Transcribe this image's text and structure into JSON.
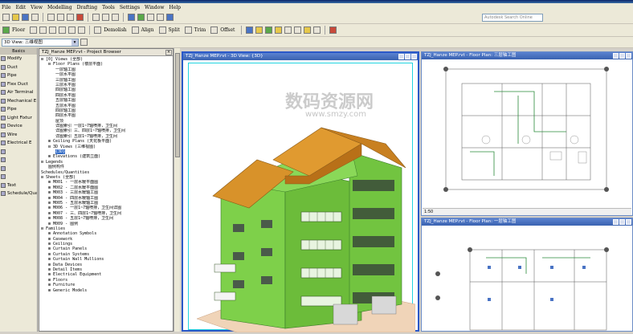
{
  "menu": [
    "File",
    "Edit",
    "View",
    "Modelling",
    "Drafting",
    "Tools",
    "Settings",
    "Window",
    "Help"
  ],
  "toolbar2": {
    "buttons": [
      "Floor",
      "Demolish",
      "Align",
      "Split",
      "Trim",
      "Offset"
    ],
    "search_placeholder": "Autodesk Search Online"
  },
  "toolbar3": {
    "view_combo": "3D View: 三维视图"
  },
  "design_bar": {
    "header": "Basics",
    "items": [
      "Modify",
      "Duct",
      "Pipe",
      "Flex Duct",
      "Air Terminal",
      "Mechanical E",
      "Pipe",
      "Light Fixtur",
      "Device",
      "Wire",
      "Electrical E",
      "",
      "",
      "",
      "",
      "Text",
      "Schedule/Qua"
    ]
  },
  "project_browser": {
    "title": "TZJ_Hanze MEP.rvt - Project Browser",
    "nodes": [
      {
        "level": 0,
        "text": "⊟ [0] Views (全部)"
      },
      {
        "level": 1,
        "text": "⊟ Floor Plans (楼层平面)"
      },
      {
        "level": 2,
        "text": "一层轴工图"
      },
      {
        "level": 2,
        "text": "一层水平图"
      },
      {
        "level": 2,
        "text": "三层轴工图"
      },
      {
        "level": 2,
        "text": "三层水平图"
      },
      {
        "level": 2,
        "text": "四层轴工图"
      },
      {
        "level": 2,
        "text": "四层水平图"
      },
      {
        "level": 2,
        "text": "五层轴工图"
      },
      {
        "level": 2,
        "text": "五层水平图"
      },
      {
        "level": 2,
        "text": "四层轴工图"
      },
      {
        "level": 2,
        "text": "四层水平图"
      },
      {
        "level": 2,
        "text": "屋顶"
      },
      {
        "level": 2,
        "text": "详图索引 一层1~7轴喷排，卫生间"
      },
      {
        "level": 2,
        "text": "详图索引 三、四层1~7轴喷排，卫生间"
      },
      {
        "level": 2,
        "text": "详图索引 五层1~7轴喷排，卫生间"
      },
      {
        "level": 1,
        "text": "⊞ Ceiling Plans (天花板平面)"
      },
      {
        "level": 1,
        "text": "⊟ 3D Views (三维视图)"
      },
      {
        "level": 2,
        "text": "{3D}",
        "selected": true
      },
      {
        "level": 1,
        "text": "⊞ Elevations (建筑立面)"
      },
      {
        "level": 0,
        "text": "⊟ Legends"
      },
      {
        "level": 1,
        "text": "图例构件"
      },
      {
        "level": 0,
        "text": "Schedules/Quantities"
      },
      {
        "level": 0,
        "text": "⊟ Sheets (全部)"
      },
      {
        "level": 1,
        "text": "⊞ M001 - 一层水暖平面图"
      },
      {
        "level": 1,
        "text": "⊞ M002 - 二层水暖平面图"
      },
      {
        "level": 1,
        "text": "⊞ M003 - 三层水暖轴工图"
      },
      {
        "level": 1,
        "text": "⊞ M004 - 四层水暖轴工图"
      },
      {
        "level": 1,
        "text": "⊞ M005 - 五层水暖轴工图"
      },
      {
        "level": 1,
        "text": "⊞ M006 - 一层1~7轴喷排，卫生间详图"
      },
      {
        "level": 1,
        "text": "⊞ M007 - 三、四层1~7轴喷排，卫生间"
      },
      {
        "level": 1,
        "text": "⊞ M008 - 五层1~7轴喷排，卫生间"
      },
      {
        "level": 1,
        "text": "⊞ M009 - 图例"
      },
      {
        "level": 0,
        "text": "⊟ Families"
      },
      {
        "level": 1,
        "text": "⊞ Annotation Symbols"
      },
      {
        "level": 1,
        "text": "⊞ Casework"
      },
      {
        "level": 1,
        "text": "⊞ Ceilings"
      },
      {
        "level": 1,
        "text": "⊞ Curtain Panels"
      },
      {
        "level": 1,
        "text": "⊞ Curtain Systems"
      },
      {
        "level": 1,
        "text": "⊞ Curtain Wall Mullions"
      },
      {
        "level": 1,
        "text": "⊞ Data Devices"
      },
      {
        "level": 1,
        "text": "⊞ Detail Items"
      },
      {
        "level": 1,
        "text": "⊞ Electrical Equipment"
      },
      {
        "level": 1,
        "text": "⊞ Floors"
      },
      {
        "level": 1,
        "text": "⊞ Furniture"
      },
      {
        "level": 1,
        "text": "⊞ Generic Models"
      }
    ]
  },
  "views": {
    "v3d_title": "TZJ_Hanze MEP.rvt - 3D View: {3D}",
    "plan1_title": "TZJ_Hanze MEP.rvt - Floor Plan: 三层轴工图",
    "plan2_title": "TZJ_Hanze MEP.rvt - Floor Plan: 一层轴工图",
    "plan1_scale": "1:50"
  },
  "watermark": {
    "cn": "数码资源网",
    "url": "www.smzy.com"
  }
}
